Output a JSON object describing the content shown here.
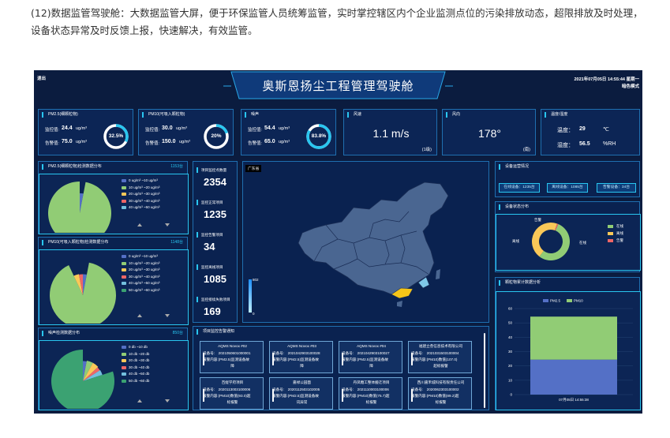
{
  "caption": "(12)数据监管驾驶舱：大数据监管大屏，便于环保监管人员统筹监管，实时掌控辖区内个企业监测点位的污染排放动态，超限排放及时处理，设备状态异常及时反馈上报，快速解决，有效监管。",
  "header": {
    "exit": "退出",
    "title": "奥斯恩扬尘工程管理驾驶舱",
    "datetime": "2021年07月05日 14:55:44 星期一",
    "mode": "暗色模式"
  },
  "cards": [
    {
      "title": "PM2.5(细颗粒物)",
      "row1_label": "监控值:",
      "row1_value": "24.4",
      "row1_unit": "ug/m³",
      "row2_label": "告警值:",
      "row2_value": "75.0",
      "row2_unit": "ug/m³",
      "pct": "32.5%",
      "pct_value": 32.5
    },
    {
      "title": "PM10(可吸入颗粒物)",
      "row1_label": "监控值:",
      "row1_value": "30.0",
      "row1_unit": "ug/m³",
      "row2_label": "告警值:",
      "row2_value": "150.0",
      "row2_unit": "ug/m³",
      "pct": "20%",
      "pct_value": 20
    },
    {
      "title": "噪声",
      "row1_label": "监控值:",
      "row1_value": "54.4",
      "row1_unit": "ug/m³",
      "row2_label": "告警值:",
      "row2_value": "65.0",
      "row2_unit": "ug/m³",
      "pct": "83.8%",
      "pct_value": 83.8
    }
  ],
  "wind_speed": {
    "title": "风速",
    "value": "1.1 m/s",
    "level": "(1级)"
  },
  "wind_dir": {
    "title": "风向",
    "value": "178°",
    "dir": "(南)"
  },
  "temp_hum": {
    "title": "温度/湿度",
    "temp_label": "温度：",
    "temp_value": "29",
    "temp_unit": "℃",
    "hum_label": "湿度：",
    "hum_value": "56.5",
    "hum_unit": "%RH"
  },
  "pm25_dist": {
    "title": "PM2.5(细颗粒物)检测数据分布",
    "count": "1153台",
    "legend": [
      "0 ug/m³ ~10 ug/m³",
      "10 ug/m³ ~20 ug/m³",
      "20 ug/m³ ~30 ug/m³",
      "30 ug/m³ ~40 ug/m³",
      "40 ug/m³ ~50 ug/m³"
    ],
    "colors": [
      "#5470c6",
      "#91cc75",
      "#fac858",
      "#ee6666",
      "#73c0de"
    ],
    "values": [
      0.03,
      0.97,
      0,
      0,
      0
    ]
  },
  "pm10_dist": {
    "title": "PM10(可吸入颗粒物)检测数据分布",
    "count": "1148台",
    "legend": [
      "0 ug/m³ ~10 ug/m³",
      "10 ug/m³ ~20 ug/m³",
      "20 ug/m³ ~30 ug/m³",
      "30 ug/m³ ~40 ug/m³",
      "40 ug/m³ ~50 ug/m³",
      "50 ug/m³ ~60 ug/m³"
    ],
    "colors": [
      "#5470c6",
      "#91cc75",
      "#fac858",
      "#ee6666",
      "#73c0de",
      "#3ba272"
    ],
    "values": [
      0.03,
      0.9,
      0.04,
      0.03,
      0,
      0
    ]
  },
  "noise_dist": {
    "title": "噪声检测数据分布",
    "count": "850台",
    "legend": [
      "0 db ~10 db",
      "10 db ~20 db",
      "20 db ~30 db",
      "30 db ~40 db",
      "40 db ~50 db",
      "50 db ~60 db"
    ],
    "colors": [
      "#5470c6",
      "#91cc75",
      "#fac858",
      "#ee6666",
      "#73c0de",
      "#3ba272"
    ],
    "values": [
      0.03,
      0.05,
      0.05,
      0.03,
      0.04,
      0.8
    ]
  },
  "stats": [
    {
      "label": "项目监控点数量",
      "value": "2354"
    },
    {
      "label": "监控正常项目",
      "value": "1235"
    },
    {
      "label": "监控告警项目",
      "value": "34"
    },
    {
      "label": "监控离线项目",
      "value": "1085"
    },
    {
      "label": "监控接续失败项目",
      "value": "169"
    }
  ],
  "map": {
    "province": "广东省",
    "scale_max": "802",
    "scale_min": "0"
  },
  "device_overview": {
    "title": "设备运营情况",
    "online": "在线设备：1235台",
    "offline": "离线设备：1085台",
    "alarm": "告警设备：34台"
  },
  "device_status": {
    "title": "设备状态分布",
    "labels": {
      "alarm": "告警",
      "offline": "离线",
      "online": "在线"
    },
    "legend": [
      "在线",
      "离线",
      "告警"
    ],
    "colors": [
      "#91cc75",
      "#fac858",
      "#ee6666"
    ],
    "values": [
      0.54,
      0.45,
      0.01
    ]
  },
  "bar_panel": {
    "title": "颗粒物累计数据分析"
  },
  "chart_data": {
    "type": "bar",
    "categories": [
      "07月05日 14:55:38"
    ],
    "series": [
      {
        "name": "PM2.5",
        "values": [
          24.4
        ],
        "color": "#5470c6"
      },
      {
        "name": "PM10",
        "values": [
          30
        ],
        "color": "#91cc75"
      }
    ],
    "stacked": true,
    "ylim": [
      0,
      60
    ],
    "yticks": [
      "0",
      "10",
      "20",
      "30",
      "40",
      "50",
      "60"
    ]
  },
  "alarm_panel": {
    "title": "项目监控告警通知"
  },
  "alarms": [
    {
      "name": "AQMS Novox #02",
      "no": "设备号:　2021050601000001",
      "content": "报警内容:(PM2.5)监测设备故",
      "extra": "障"
    },
    {
      "name": "AQMS Novox #03",
      "no": "设备号:　2021042903100028",
      "content": "报警内容:(PM2.5)监测设备故",
      "extra": "障"
    },
    {
      "name": "AQMS Novox #04",
      "no": "设备号:　2021042903100027",
      "content": "报警内容:(PM2.5)监测设备故",
      "extra": "障"
    },
    {
      "name": "福建立叁信息技术有限公司",
      "no": "设备号:　2021031503100004",
      "content": "报警内容:(PM10)数值(107.0)",
      "extra": "超标报警"
    },
    {
      "name": "百缇学府项目",
      "no": "设备号:　2020113003100006",
      "content": "报警内容:(PM10)数值(93.0)超",
      "extra": "标报警"
    },
    {
      "name": "嘉禄公园面",
      "no": "设备号:　2020112503102005",
      "content": "报警内容:(PM2.5)监测设备故",
      "extra": "讯异常"
    },
    {
      "name": "丹凤糖工整体搬迁项目",
      "no": "设备号:　2021110003100006",
      "content": "报警内容:(PM10)数值(75.7)超",
      "extra": "标报警"
    },
    {
      "name": "西川嘉禾城科技有限责任公司",
      "no": "设备号:　2020062303100002",
      "content": "报警内容:(PM10)数值(89.2)超",
      "extra": "标报警"
    }
  ]
}
